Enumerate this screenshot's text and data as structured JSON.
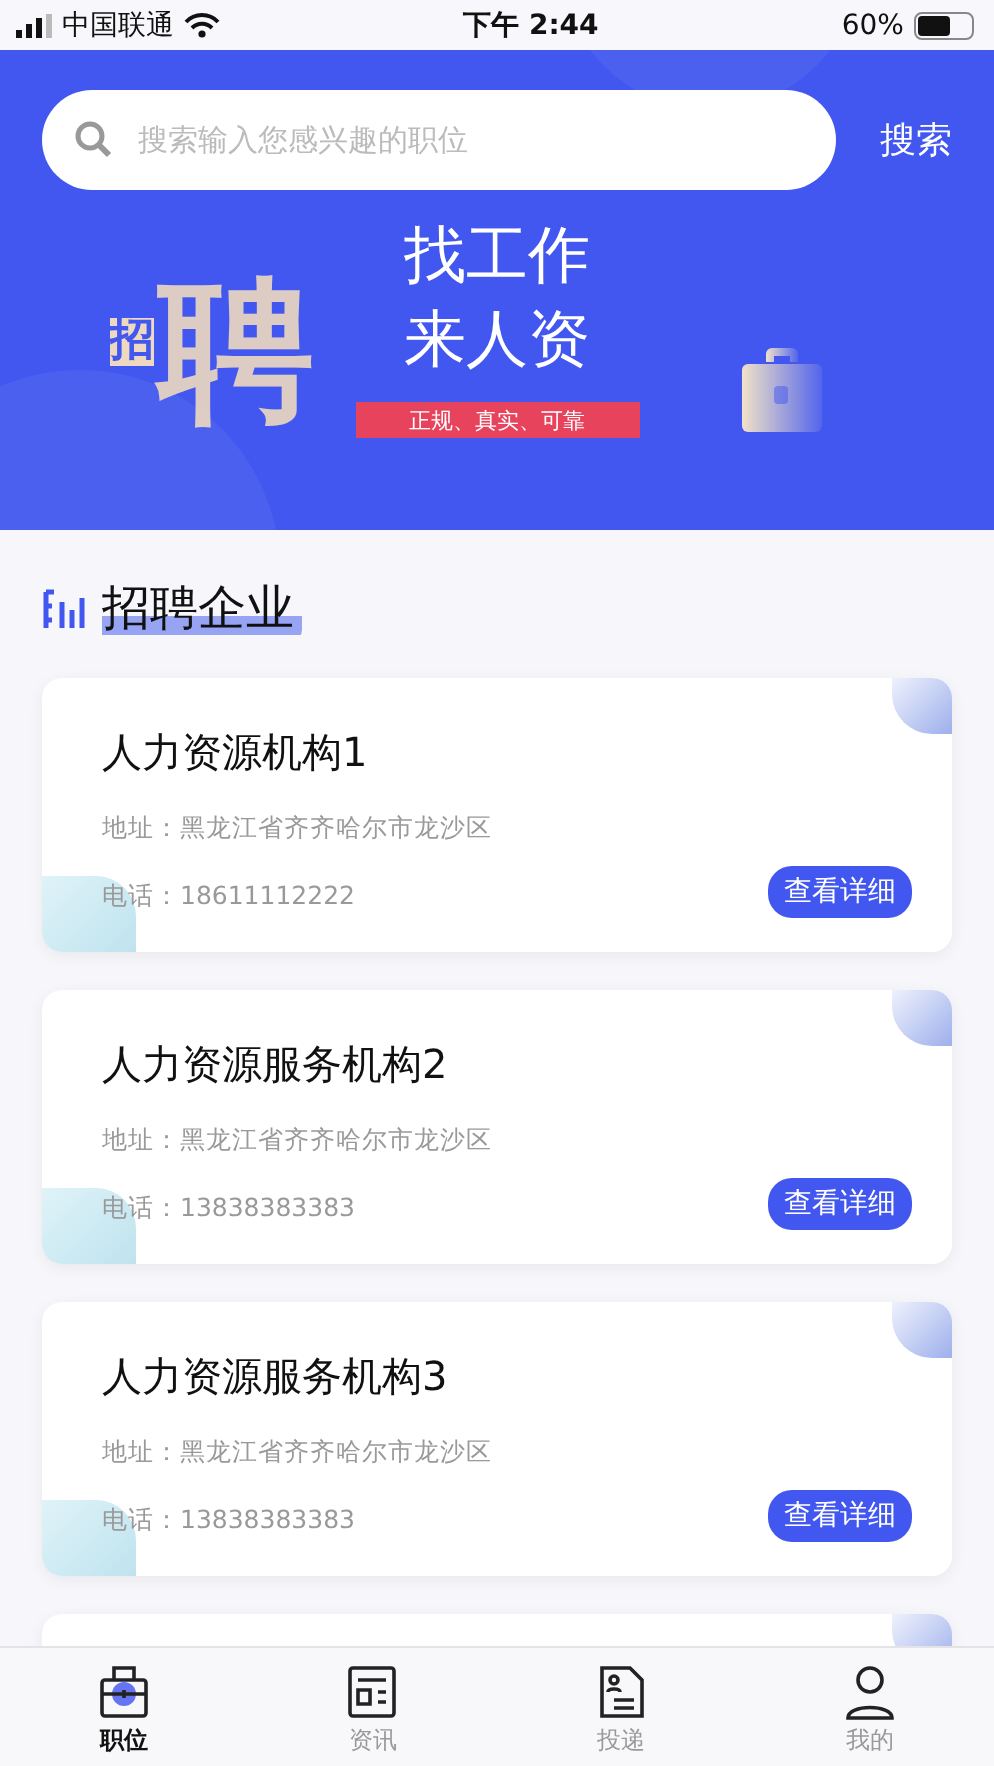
{
  "status_bar": {
    "carrier": "中国联通",
    "time": "下午 2:44",
    "battery": "60%"
  },
  "search": {
    "placeholder": "搜索输入您感兴趣的职位",
    "button": "搜索"
  },
  "banner": {
    "art_big": "聘",
    "art_small": "招",
    "title_lines": [
      "找工作",
      "来人资"
    ],
    "tag": "正规、真实、可靠"
  },
  "section_title": "招聘企业",
  "companies": [
    {
      "name": "人力资源机构1",
      "address": "地址：黑龙江省齐齐哈尔市龙沙区",
      "phone": "电话：18611112222",
      "button": "查看详细"
    },
    {
      "name": "人力资源服务机构2",
      "address": "地址：黑龙江省齐齐哈尔市龙沙区",
      "phone": "电话：13838383383",
      "button": "查看详细"
    },
    {
      "name": "人力资源服务机构3",
      "address": "地址：黑龙江省齐齐哈尔市龙沙区",
      "phone": "电话：13838383383",
      "button": "查看详细"
    }
  ],
  "tabs": [
    {
      "kind": "job",
      "label": "职位",
      "selected": true
    },
    {
      "kind": "news",
      "label": "资讯",
      "selected": false
    },
    {
      "kind": "resume",
      "label": "投递",
      "selected": false
    },
    {
      "kind": "user",
      "label": "我的",
      "selected": false
    }
  ]
}
